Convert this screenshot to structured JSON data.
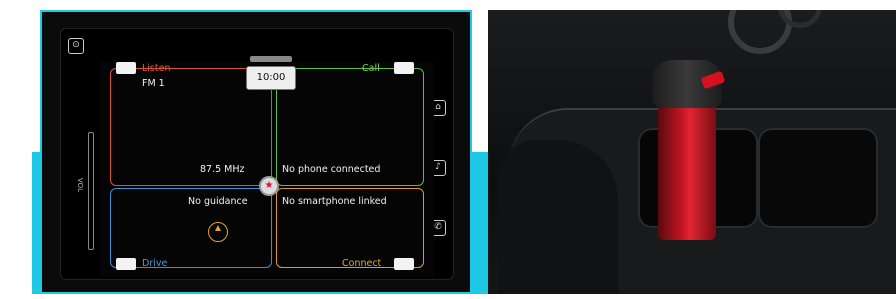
{
  "infotainment": {
    "clock": "10:00",
    "listen": {
      "label": "Listen",
      "station": "FM 1",
      "frequency": "87.5 MHz"
    },
    "call": {
      "label": "Call",
      "status": "No phone connected"
    },
    "drive": {
      "label": "Drive",
      "status": "No guidance"
    },
    "connect": {
      "label": "Connect",
      "status": "No smartphone linked"
    },
    "volume_label": "VOL"
  },
  "colors": {
    "accent_strip": "#1ec9e6",
    "listen": "#d9533e",
    "call": "#5bbf3a",
    "drive": "#3c8fd6",
    "connect": "#e09a2a",
    "mug": "#c01420"
  },
  "icons": {
    "settings": "settings-icon",
    "home": "home-icon",
    "voice": "voice-icon",
    "phone": "phone-icon",
    "favorite": "star-icon",
    "compass": "compass-icon"
  }
}
